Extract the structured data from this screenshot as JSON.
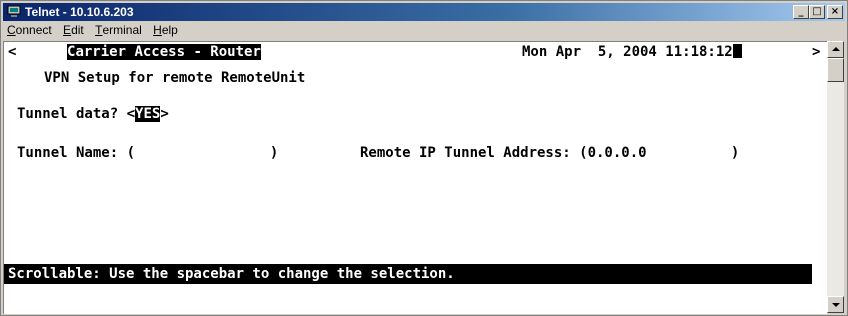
{
  "window": {
    "title": "Telnet - 10.10.6.203",
    "buttons": {
      "minimize": "_",
      "maximize": "□",
      "close": "×"
    }
  },
  "menu": [
    {
      "label": "Connect",
      "accel": "C",
      "rest": "onnect"
    },
    {
      "label": "Edit",
      "accel": "E",
      "rest": "dit"
    },
    {
      "label": "Terminal",
      "accel": "T",
      "rest": "erminal"
    },
    {
      "label": "Help",
      "accel": "H",
      "rest": "elp"
    }
  ],
  "terminal": {
    "left_arrow": "<",
    "right_arrow": ">",
    "header_title": "Carrier Access - Router",
    "datetime": "Mon Apr  5, 2004 11:18:12",
    "screen_title": "VPN Setup for remote RemoteUnit",
    "tunnel_data_label": "Tunnel data? <",
    "tunnel_data_value": "YES",
    "tunnel_data_close": ">",
    "tunnel_name_label": "Tunnel Name: (",
    "tunnel_name_value": "          ",
    "tunnel_name_close": ")",
    "remote_ip_label": "Remote IP Tunnel Address: (",
    "remote_ip_value": "0.0.0.0",
    "remote_ip_close": ")",
    "status_message": "Scrollable: Use the spacebar to change the selection."
  },
  "colors": {
    "titlebar_start": "#0a246a",
    "titlebar_end": "#a6caf0",
    "terminal_bg": "#ffffff",
    "terminal_fg": "#000000"
  }
}
